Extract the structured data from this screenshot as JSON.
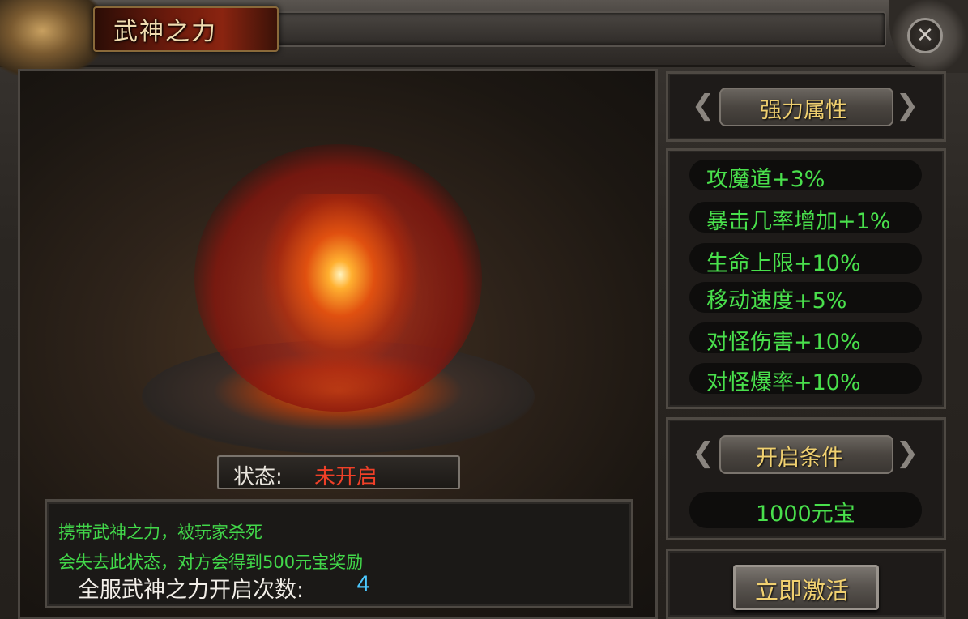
{
  "window": {
    "title": "武神之力"
  },
  "stage": {
    "status_label": "状态:",
    "status_value": "未开启",
    "info_line1": "携带武神之力，被玩家杀死",
    "info_line2": "会失去此状态，对方会得到500元宝奖励",
    "count_label": "全服武神之力开启次数:",
    "count_value": "4"
  },
  "attributes": {
    "header": "强力属性",
    "items": [
      "攻魔道+3%",
      "暴击几率增加+1%",
      "生命上限+10%",
      "移动速度+5%",
      "对怪伤害+10%",
      "对怪爆率+10%"
    ]
  },
  "condition": {
    "header": "开启条件",
    "cost": "1000元宝"
  },
  "activate": {
    "label": "立即激活"
  },
  "colors": {
    "attribute_green": "#49e04c",
    "status_red": "#f04028",
    "count_blue": "#4cc8ff",
    "header_gold": "#f0d070"
  },
  "icons": {
    "close": "close-icon"
  }
}
